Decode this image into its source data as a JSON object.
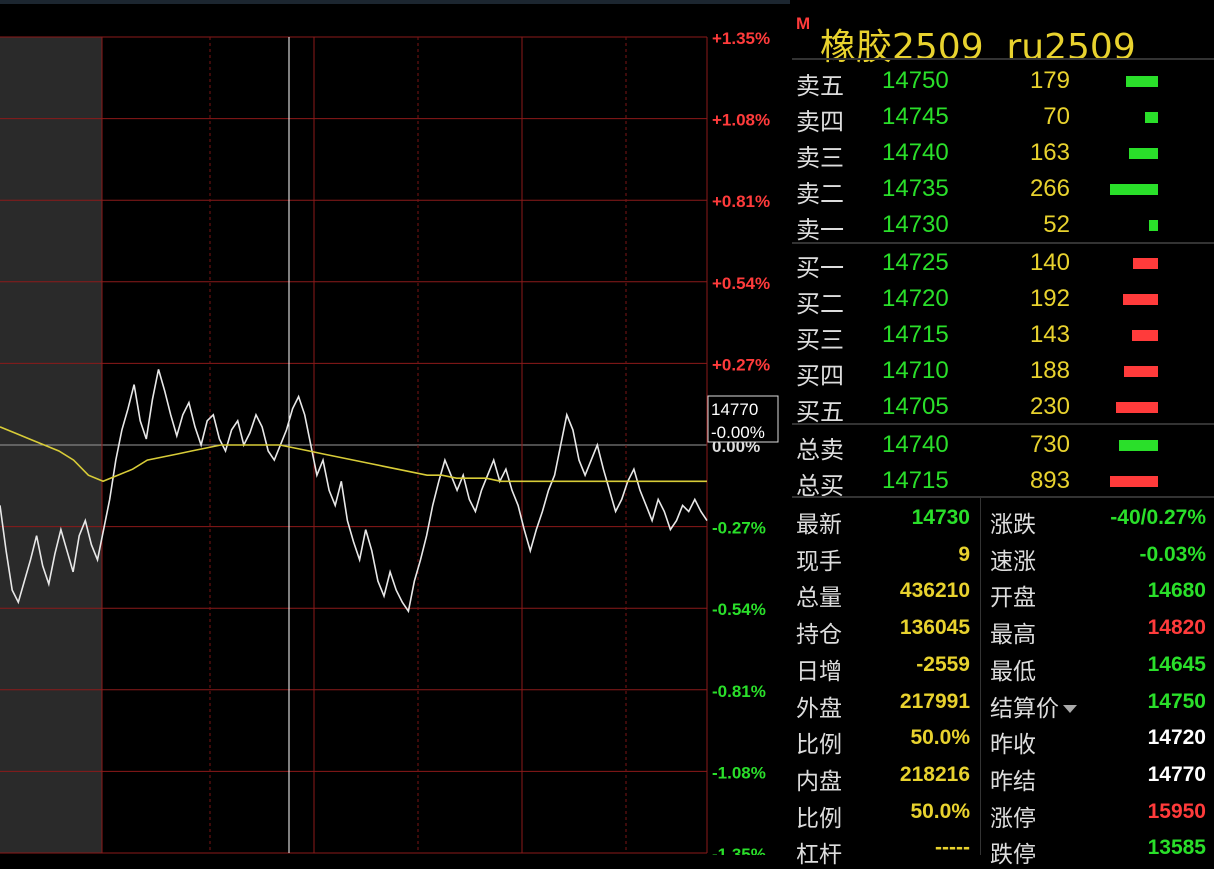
{
  "title": {
    "badge": "M",
    "text": "橡胶2509  ru2509"
  },
  "colors": {
    "up": "#ff3b3b",
    "down": "#2adf2a",
    "yellow": "#e8d22e",
    "white": "#ffffff"
  },
  "orderbook": {
    "asks": [
      {
        "label": "卖五",
        "price": "14750",
        "vol": "179",
        "n": 179
      },
      {
        "label": "卖四",
        "price": "14745",
        "vol": "70",
        "n": 70
      },
      {
        "label": "卖三",
        "price": "14740",
        "vol": "163",
        "n": 163
      },
      {
        "label": "卖二",
        "price": "14735",
        "vol": "266",
        "n": 266
      },
      {
        "label": "卖一",
        "price": "14730",
        "vol": "52",
        "n": 52
      }
    ],
    "bids": [
      {
        "label": "买一",
        "price": "14725",
        "vol": "140",
        "n": 140
      },
      {
        "label": "买二",
        "price": "14720",
        "vol": "192",
        "n": 192
      },
      {
        "label": "买三",
        "price": "14715",
        "vol": "143",
        "n": 143
      },
      {
        "label": "买四",
        "price": "14710",
        "vol": "188",
        "n": 188
      },
      {
        "label": "买五",
        "price": "14705",
        "vol": "230",
        "n": 230
      }
    ],
    "totals": [
      {
        "label": "总卖",
        "price": "14740",
        "vol": "730",
        "n": 730,
        "side": "ask"
      },
      {
        "label": "总买",
        "price": "14715",
        "vol": "893",
        "n": 893,
        "side": "bid"
      }
    ]
  },
  "stats_left": [
    {
      "k": "最新",
      "v": "14730",
      "c": "down"
    },
    {
      "k": "现手",
      "v": "9",
      "c": "yellow"
    },
    {
      "k": "总量",
      "v": "436210",
      "c": "yellow"
    },
    {
      "k": "持仓",
      "v": "136045",
      "c": "yellow"
    },
    {
      "k": "日增",
      "v": "-2559",
      "c": "yellow"
    },
    {
      "k": "外盘",
      "v": "217991",
      "c": "yellow"
    },
    {
      "k": "比例",
      "v": "50.0%",
      "c": "yellow"
    },
    {
      "k": "内盘",
      "v": "218216",
      "c": "yellow"
    },
    {
      "k": "比例",
      "v": "50.0%",
      "c": "yellow"
    },
    {
      "k": "杠杆",
      "v": "-----",
      "c": "yellow"
    }
  ],
  "stats_right": [
    {
      "k": "涨跌",
      "v": "-40/0.27%",
      "c": "down"
    },
    {
      "k": "速涨",
      "v": "-0.03%",
      "c": "down"
    },
    {
      "k": "开盘",
      "v": "14680",
      "c": "down"
    },
    {
      "k": "最高",
      "v": "14820",
      "c": "up"
    },
    {
      "k": "最低",
      "v": "14645",
      "c": "down"
    },
    {
      "k": "结算价",
      "v": "14750",
      "c": "down",
      "dropdown": true
    },
    {
      "k": "昨收",
      "v": "14720",
      "c": "white"
    },
    {
      "k": "昨结",
      "v": "14770",
      "c": "white"
    },
    {
      "k": "涨停",
      "v": "15950",
      "c": "up"
    },
    {
      "k": "跌停",
      "v": "13585",
      "c": "down"
    }
  ],
  "chart_data": {
    "type": "line",
    "y_ticks_pct": [
      "+1.35%",
      "+1.08%",
      "+0.81%",
      "+0.54%",
      "+0.27%",
      "0.00%",
      "-0.27%",
      "-0.54%",
      "-0.81%",
      "-1.08%",
      "-1.35%"
    ],
    "ylim_pct": [
      -1.35,
      1.35
    ],
    "reference_price": 14770,
    "cursor_readout": {
      "price": "14770",
      "pct": "-0.00%"
    },
    "series": [
      {
        "color": "white",
        "values_pct": [
          -0.2,
          -0.35,
          -0.48,
          -0.52,
          -0.45,
          -0.38,
          -0.3,
          -0.4,
          -0.46,
          -0.36,
          -0.28,
          -0.35,
          -0.42,
          -0.3,
          -0.25,
          -0.33,
          -0.38,
          -0.28,
          -0.18,
          -0.05,
          0.05,
          0.12,
          0.2,
          0.08,
          0.02,
          0.15,
          0.25,
          0.18,
          0.1,
          0.03,
          0.1,
          0.14,
          0.06,
          0.0,
          0.08,
          0.1,
          0.02,
          -0.02,
          0.05,
          0.08,
          0.0,
          0.04,
          0.1,
          0.06,
          -0.02,
          -0.05,
          0.0,
          0.05,
          0.12,
          0.16,
          0.1,
          0.0,
          -0.1,
          -0.05,
          -0.15,
          -0.2,
          -0.12,
          -0.25,
          -0.32,
          -0.38,
          -0.28,
          -0.35,
          -0.45,
          -0.5,
          -0.42,
          -0.48,
          -0.52,
          -0.55,
          -0.45,
          -0.38,
          -0.3,
          -0.2,
          -0.12,
          -0.05,
          -0.1,
          -0.15,
          -0.1,
          -0.18,
          -0.22,
          -0.15,
          -0.1,
          -0.05,
          -0.12,
          -0.08,
          -0.15,
          -0.2,
          -0.28,
          -0.35,
          -0.28,
          -0.22,
          -0.15,
          -0.1,
          0.0,
          0.1,
          0.05,
          -0.05,
          -0.1,
          -0.05,
          0.0,
          -0.08,
          -0.15,
          -0.22,
          -0.18,
          -0.12,
          -0.08,
          -0.15,
          -0.2,
          -0.25,
          -0.18,
          -0.22,
          -0.28,
          -0.25,
          -0.2,
          -0.22,
          -0.18,
          -0.22,
          -0.25
        ]
      },
      {
        "color": "yellow",
        "values_pct": [
          0.06,
          0.04,
          0.02,
          0.0,
          -0.02,
          -0.05,
          -0.1,
          -0.12,
          -0.1,
          -0.08,
          -0.05,
          -0.04,
          -0.03,
          -0.02,
          -0.01,
          0.0,
          0.0,
          0.0,
          0.0,
          0.0,
          -0.01,
          -0.02,
          -0.03,
          -0.04,
          -0.05,
          -0.06,
          -0.07,
          -0.08,
          -0.09,
          -0.1,
          -0.1,
          -0.11,
          -0.11,
          -0.11,
          -0.12,
          -0.12,
          -0.12,
          -0.12,
          -0.12,
          -0.12,
          -0.12,
          -0.12,
          -0.12,
          -0.12,
          -0.12,
          -0.12,
          -0.12,
          -0.12,
          -0.12
        ]
      }
    ],
    "grid": true
  }
}
